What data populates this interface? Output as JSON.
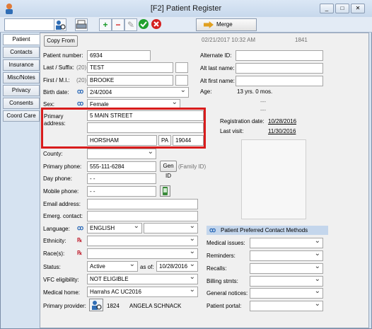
{
  "window": {
    "title": "[F2] Patient Register",
    "min": "_",
    "max": "□",
    "close": "✕"
  },
  "toolbar": {
    "search_value": "",
    "merge_label": "Merge",
    "add": "+",
    "remove": "−",
    "edit": "✎"
  },
  "tabs": [
    "Patient",
    "Contacts",
    "Insurance",
    "Misc/Notes",
    "Privacy",
    "Consents",
    "Coord Care"
  ],
  "header": {
    "copy_from": "Copy From",
    "timestamp": "02/21/2017  10:32 AM",
    "id": "1841"
  },
  "patient": {
    "number_label": "Patient number:",
    "number": "6934",
    "last_label": "Last / Suffix:",
    "last_len": "(20)",
    "last": "TEST",
    "suffix": "",
    "first_label": "First / M.I.:",
    "first_len": "(20)",
    "first": "BROOKE",
    "mi": "",
    "birth_label": "Birth date:",
    "birth": "2/4/2004",
    "sex_label": "Sex:",
    "sex": "Female",
    "addr_label1": "Primary",
    "addr_label2": "address:",
    "addr1": "5 MAIN STREET",
    "addr2": "",
    "city": "HORSHAM",
    "state": "PA",
    "zip": "19044",
    "county_label": "County:",
    "county": "",
    "phone_label": "Primary phone:",
    "phone": "555-111-6284",
    "gen_id": "Gen ID",
    "family_id": "(Family ID)",
    "day_label": "Day phone:",
    "day": "-   -",
    "mobile_label": "Mobile phone:",
    "mobile": "-   -",
    "email_label": "Email address:",
    "email": "",
    "emerg_label": "Emerg. contact:",
    "emerg": "",
    "lang_label": "Language:",
    "lang": "ENGLISH",
    "lang2": "",
    "eth_label": "Ethnicity:",
    "eth": "",
    "race_label": "Race(s):",
    "race": "",
    "status_label": "Status:",
    "status": "Active",
    "asof_label": "as of:",
    "asof": "10/28/2016",
    "vfc_label": "VFC eligibility:",
    "vfc": "NOT ELIGIBLE",
    "home_label": "Medical home:",
    "home": "Harrahs AC UC2016",
    "prov_label": "Primary provider:",
    "prov_id": "1824",
    "prov_name": "ANGELA SCHNACK"
  },
  "right": {
    "alt_id_label": "Alternate ID:",
    "alt_last_label": "Alt last name:",
    "alt_first_label": "Alt first name:",
    "age_label": "Age:",
    "age": "13 yrs. 0 mos.",
    "dash1": "---",
    "dash2": "---",
    "reg_label": "Registration date:",
    "reg": "10/28/2016",
    "visit_label": "Last visit:",
    "visit": "11/30/2016"
  },
  "contact_methods": {
    "title": "Patient Preferred Contact Methods",
    "rows": [
      "Medical issues:",
      "Reminders:",
      "Recalls:",
      "Billing stmts:",
      "General notices:",
      "Patient portal:"
    ]
  }
}
